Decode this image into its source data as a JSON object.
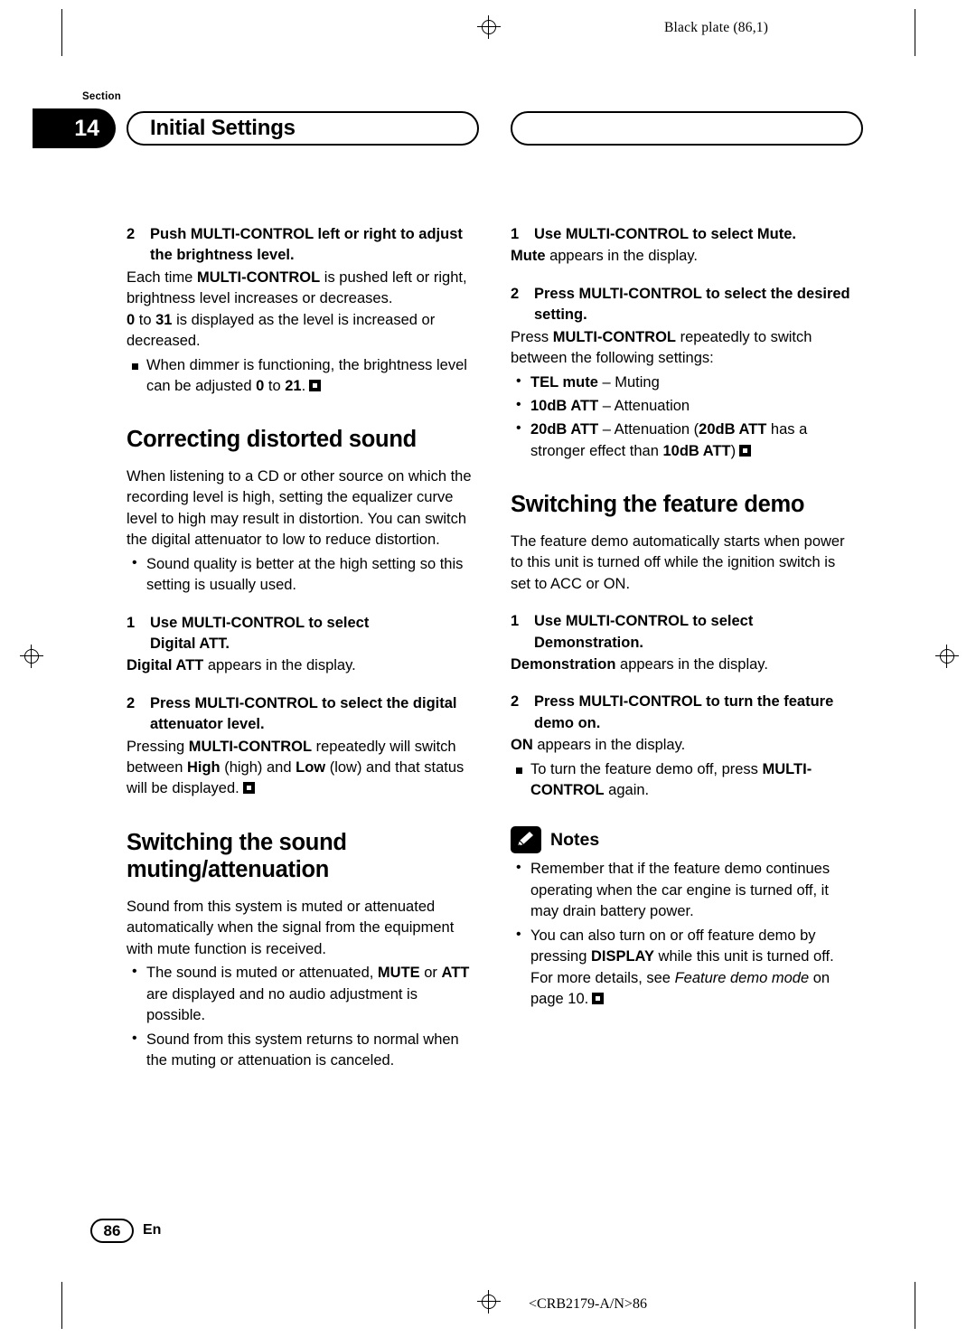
{
  "header": {
    "black_plate": "Black plate (86,1)",
    "section_word": "Section",
    "section_number": "14",
    "title": "Initial Settings"
  },
  "left_column": {
    "step_brightness": {
      "num": "2",
      "text_parts": [
        "Push MULTI-CONTROL left or right to adjust the brightness level."
      ],
      "body1": "Each time MULTI-CONTROL is pushed left or right, brightness level increases or decreases.",
      "body2": "0 to 31 is displayed as the level is increased or decreased.",
      "note": "When dimmer is functioning, the brightness level can be adjusted 0 to 21."
    },
    "heading_correcting": "Correcting distorted sound",
    "correcting_body": "When listening to a CD or other source on which the recording level is high, setting the equalizer curve level to high may result in distortion. You can switch the digital attenuator to low to reduce distortion.",
    "correcting_bullet": "Sound quality is better at the high setting so this setting is usually used.",
    "step_digital_att": {
      "num": "1",
      "text": "Use MULTI-CONTROL to select Digital ATT.",
      "body": "Digital ATT appears in the display."
    },
    "step_digital_level": {
      "num": "2",
      "text": "Press MULTI-CONTROL to select the digital attenuator level.",
      "body": "Pressing MULTI-CONTROL repeatedly will switch between High (high) and Low (low) and that status will be displayed."
    },
    "heading_muting": "Switching the sound muting/attenuation",
    "muting_body": "Sound from this system is muted or attenuated automatically when the signal from the equipment with mute function is received.",
    "muting_bullets": [
      "The sound is muted or attenuated, MUTE or ATT are displayed and no audio adjustment is possible.",
      "Sound from this system returns to normal when the muting or attenuation is canceled."
    ]
  },
  "right_column": {
    "step_mute": {
      "num": "1",
      "text": "Use MULTI-CONTROL to select Mute.",
      "body": "Mute appears in the display."
    },
    "step_desired": {
      "num": "2",
      "text": "Press MULTI-CONTROL to select the desired setting.",
      "body": "Press MULTI-CONTROL repeatedly to switch between the following settings:",
      "options": [
        "TEL mute – Muting",
        "10dB ATT – Attenuation",
        "20dB ATT – Attenuation (20dB ATT has a stronger effect than 10dB ATT)"
      ]
    },
    "heading_demo": "Switching the feature demo",
    "demo_body": "The feature demo automatically starts when power to this unit is turned off while the ignition switch is set to ACC or ON.",
    "step_demo1": {
      "num": "1",
      "text": "Use MULTI-CONTROL to select Demonstration.",
      "body": "Demonstration appears in the display."
    },
    "step_demo2": {
      "num": "2",
      "text": "Press MULTI-CONTROL to turn the feature demo on.",
      "body": "ON appears in the display.",
      "note": "To turn the feature demo off, press MULTI-CONTROL again."
    },
    "notes_title": "Notes",
    "notes": [
      "Remember that if the feature demo continues operating when the car engine is turned off, it may drain battery power.",
      "You can also turn on or off feature demo by pressing DISPLAY while this unit is turned off. For more details, see Feature demo mode on page 10."
    ]
  },
  "footer": {
    "page_number": "86",
    "language": "En",
    "code": "<CRB2179-A/N>86"
  }
}
